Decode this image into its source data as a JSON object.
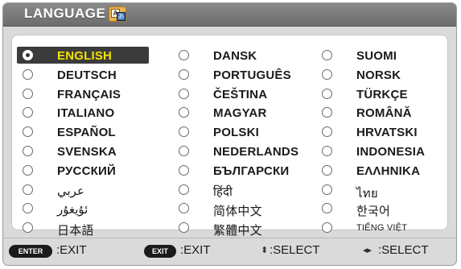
{
  "window": {
    "title": "LANGUAGE",
    "icon": "language-icon",
    "icon_glyph_a": "A",
    "icon_glyph_b": "あ"
  },
  "languages": {
    "columns": [
      [
        {
          "label": "ENGLISH",
          "selected": true
        },
        {
          "label": "DEUTSCH"
        },
        {
          "label": "FRANÇAIS"
        },
        {
          "label": "ITALIANO"
        },
        {
          "label": "ESPAÑOL"
        },
        {
          "label": "SVENSKA"
        },
        {
          "label": "РУССКИЙ"
        },
        {
          "label": "عربي"
        },
        {
          "label": "ئۇيغۇر"
        },
        {
          "label": "日本語"
        }
      ],
      [
        {
          "label": "DANSK"
        },
        {
          "label": "PORTUGUÊS"
        },
        {
          "label": "ČEŠTINA"
        },
        {
          "label": "MAGYAR"
        },
        {
          "label": "POLSKI"
        },
        {
          "label": "NEDERLANDS"
        },
        {
          "label": "БЪЛГАРСКИ"
        },
        {
          "label": "हिंदी"
        },
        {
          "label": "简体中文"
        },
        {
          "label": "繁體中文"
        }
      ],
      [
        {
          "label": "SUOMI"
        },
        {
          "label": "NORSK"
        },
        {
          "label": "TÜRKÇE"
        },
        {
          "label": "ROMÂNĂ"
        },
        {
          "label": "HRVATSKI"
        },
        {
          "label": "INDONESIA"
        },
        {
          "label": "ΕΛΛΗΝΙΚΑ"
        },
        {
          "label": "ไทย"
        },
        {
          "label": "한국어"
        },
        {
          "label": "TIẾNG VIỆT"
        }
      ]
    ]
  },
  "footer": {
    "enter_key": "ENTER",
    "enter_action": ":EXIT",
    "exit_key": "EXIT",
    "exit_action": ":EXIT",
    "updown_glyph": "⬍",
    "updown_action": ":SELECT",
    "leftright_glyph": "◂▸",
    "leftright_action": ":SELECT"
  },
  "colors": {
    "selected_background": "#3b3b3b",
    "selected_text": "#f5e200",
    "titlebar": "#7a7a7a"
  }
}
